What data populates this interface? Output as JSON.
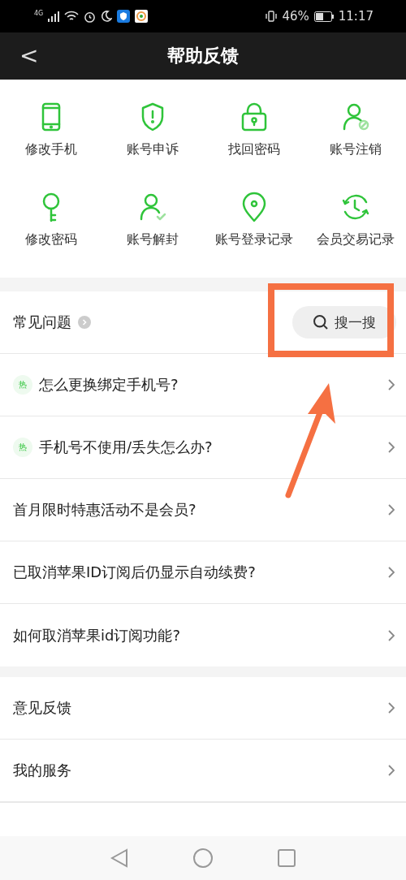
{
  "status_bar": {
    "network": "4G",
    "battery": "46%",
    "time": "11:17"
  },
  "header": {
    "back": "<",
    "title": "帮助反馈"
  },
  "shortcuts": [
    {
      "label": "修改手机"
    },
    {
      "label": "账号申诉"
    },
    {
      "label": "找回密码"
    },
    {
      "label": "账号注销"
    },
    {
      "label": "修改密码"
    },
    {
      "label": "账号解封"
    },
    {
      "label": "账号登录记录"
    },
    {
      "label": "会员交易记录"
    }
  ],
  "faq": {
    "title": "常见问题",
    "search": "搜一搜",
    "items": [
      {
        "hot": true,
        "badge": "热",
        "text": "怎么更换绑定手机号?"
      },
      {
        "hot": true,
        "badge": "热",
        "text": "手机号不使用/丢失怎么办?"
      },
      {
        "hot": false,
        "text": "首月限时特惠活动不是会员?"
      },
      {
        "hot": false,
        "text": "已取消苹果ID订阅后仍显示自动续费?"
      },
      {
        "hot": false,
        "text": "如何取消苹果id订阅功能?"
      }
    ]
  },
  "menu": [
    {
      "label": "意见反馈"
    },
    {
      "label": "我的服务"
    }
  ]
}
